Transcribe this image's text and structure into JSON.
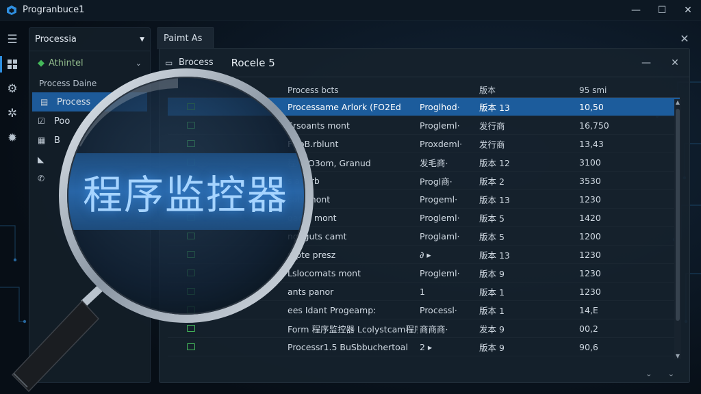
{
  "app": {
    "title": "Progranbuce1"
  },
  "window_controls": {
    "minimize": "—",
    "maximize": "☐",
    "close": "✕"
  },
  "rail": [
    "menu-icon",
    "dashboard-icon",
    "puzzle-icon",
    "gear-icon",
    "settings-icon"
  ],
  "sidepanel": {
    "header": "Processia",
    "selector": "Athintel",
    "section_label": "Process Daine",
    "items": [
      {
        "label": "Process",
        "icon": "list-icon",
        "active": true
      },
      {
        "label": "Poo",
        "icon": "edit-icon",
        "active": false
      },
      {
        "label": "B",
        "icon": "document-icon",
        "active": false
      },
      {
        "label": "",
        "icon": "file-icon",
        "active": false
      },
      {
        "label": "",
        "icon": "phone-icon",
        "active": false
      }
    ]
  },
  "tab": {
    "label": "Paimt As",
    "close": "✕"
  },
  "main": {
    "proc_label": "Brocess",
    "title": "Rocele 5",
    "controls": {
      "minimize": "—",
      "close": "✕"
    }
  },
  "table": {
    "headers": {
      "name": "Process bcts",
      "version": "版本",
      "memory": "95 smi"
    },
    "rows": [
      {
        "name": "Processame Arlork (FO2Ed",
        "publisher": "Proglhod·",
        "version": "版本 13",
        "memory": "10,50",
        "selected": true
      },
      {
        "name": "Srsoants mont",
        "publisher": "Progleml·",
        "version": "发行商",
        "memory": "16,750"
      },
      {
        "name": "FGoB.rblunt",
        "publisher": "Proxdeml·",
        "version": "发行商",
        "memory": "13,43"
      },
      {
        "name": "程序tO3om, Granud",
        "publisher": "发毛商·",
        "version": "版本 12",
        "memory": "3100"
      },
      {
        "name": "s anarb",
        "publisher": "Progl商·",
        "version": "版本 2",
        "memory": "3530"
      },
      {
        "name": "sats mont",
        "publisher": "Progeml·",
        "version": "版本 13",
        "memory": "1230"
      },
      {
        "name": "qadts mont",
        "publisher": "Progleml·",
        "version": "版本 5",
        "memory": "1420"
      },
      {
        "name": "ngeguts camt",
        "publisher": "Proglaml·",
        "version": "版本 5",
        "memory": "1200"
      },
      {
        "name": "mpte presz",
        "publisher": "∂ ▸",
        "version": "版本 13",
        "memory": "1230"
      },
      {
        "name": "Lslocomats mont",
        "publisher": "Progleml·",
        "version": "版本 9",
        "memory": "1230"
      },
      {
        "name": "ants panor",
        "publisher": "1",
        "version": "版本 1",
        "memory": "1230"
      },
      {
        "name": "ees Idant Progeamp:",
        "publisher": "Processl·",
        "version": "版本 1",
        "memory": "14,E"
      },
      {
        "name": "Form 程序监控器 Lcolystcam程序监器",
        "publisher": "商商商·",
        "version": "发本 9",
        "memory": "00,2"
      },
      {
        "name": "Processr1.5 BuSbbuchertoal",
        "publisher": "2 ▸",
        "version": "版本 9",
        "memory": "90,6"
      }
    ]
  },
  "magnifier": {
    "text": "程序监控器"
  },
  "colors": {
    "accent": "#1c5c9c",
    "background": "#0b1520",
    "icon_green": "#44b85a",
    "lens_text": "#a6d4ff"
  }
}
